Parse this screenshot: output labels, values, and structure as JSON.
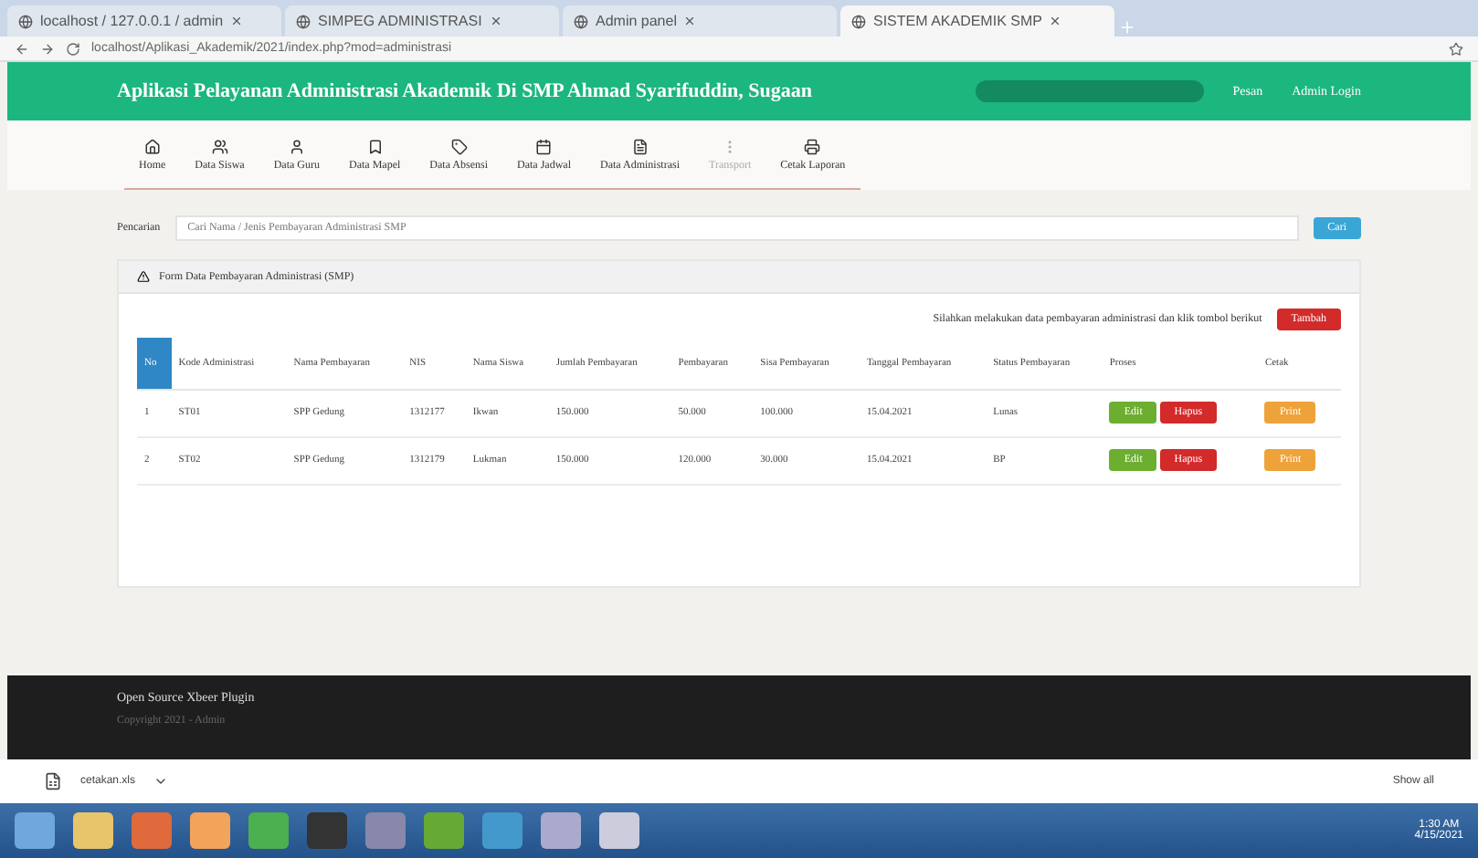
{
  "browser": {
    "tabs": [
      {
        "title": "localhost / 127.0.0.1 / admin",
        "selected": false
      },
      {
        "title": "SIMPEG ADMINISTRASI",
        "selected": false
      },
      {
        "title": "Admin panel",
        "selected": false
      },
      {
        "title": "SISTEM AKADEMIK SMP",
        "selected": true
      }
    ],
    "address": "localhost/Aplikasi_Akademik/2021/index.php?mod=administrasi"
  },
  "header": {
    "title": "Aplikasi Pelayanan Administrasi Akademik Di SMP Ahmad Syarifuddin, Sugaan",
    "links": [
      "Pesan",
      "Admin Login"
    ]
  },
  "nav": [
    {
      "label": "Home",
      "disabled": false
    },
    {
      "label": "Data Siswa",
      "disabled": false
    },
    {
      "label": "Data Guru",
      "disabled": false
    },
    {
      "label": "Data Mapel",
      "disabled": false
    },
    {
      "label": "Data Absensi",
      "disabled": false
    },
    {
      "label": "Data Jadwal",
      "disabled": false
    },
    {
      "label": "Data Administrasi",
      "disabled": false
    },
    {
      "label": "Transport",
      "disabled": true
    },
    {
      "label": "Cetak Laporan",
      "disabled": false
    }
  ],
  "search": {
    "label": "Pencarian",
    "placeholder": "Cari Nama / Jenis Pembayaran Administrasi SMP",
    "button": "Cari"
  },
  "panel": {
    "title": "Form Data Pembayaran Administrasi (SMP)",
    "hint": "Silahkan melakukan data pembayaran administrasi dan klik tombol berikut",
    "add_button": "Tambah",
    "columns": [
      "No",
      "Kode Administrasi",
      "Nama Pembayaran",
      "NIS",
      "Nama Siswa",
      "Jumlah Pembayaran",
      "Pembayaran",
      "Sisa Pembayaran",
      "Tanggal Pembayaran",
      "Status Pembayaran",
      "Proses",
      "Cetak"
    ],
    "rows": [
      {
        "cells": [
          "1",
          "ST01",
          "SPP Gedung",
          "1312177",
          "Ikwan",
          "150.000",
          "50.000",
          "100.000",
          "15.04.2021",
          "Lunas"
        ],
        "edit": "Edit",
        "delete": "Hapus",
        "print": "Print"
      },
      {
        "cells": [
          "2",
          "ST02",
          "SPP Gedung",
          "1312179",
          "Lukman",
          "150.000",
          "120.000",
          "30.000",
          "15.04.2021",
          "BP"
        ],
        "edit": "Edit",
        "delete": "Hapus",
        "print": "Print"
      }
    ]
  },
  "footer": {
    "title": "Open Source Xbeer Plugin",
    "subtitle": "Copyright 2021 - Admin"
  },
  "download_bar": {
    "file": "cetakan.xls",
    "show_all": "Show all"
  },
  "taskbar": {
    "time": "1:30 AM",
    "date": "4/15/2021"
  }
}
